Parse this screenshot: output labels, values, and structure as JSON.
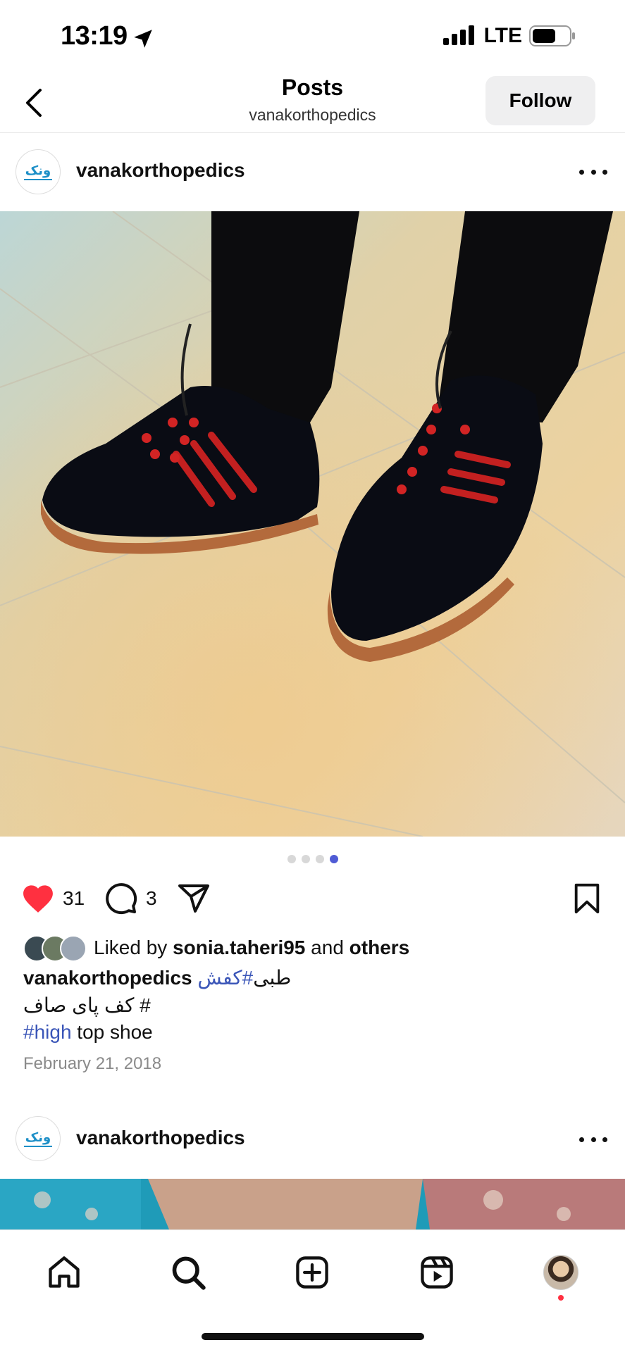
{
  "status_bar": {
    "time": "13:19",
    "network": "LTE"
  },
  "header": {
    "title": "Posts",
    "subtitle": "vanakorthopedics",
    "follow_label": "Follow"
  },
  "posts": [
    {
      "username": "vanakorthopedics",
      "avatar_logo_text": "ونک",
      "likes_count": "31",
      "comments_count": "3",
      "carousel": {
        "total": 4,
        "active_index": 3
      },
      "liked_by": {
        "prefix": "Liked by ",
        "user": "sonia.taheri95",
        "middle": " and ",
        "suffix": "others"
      },
      "caption": {
        "username": "vanakorthopedics",
        "line1_hashtag": "#کفش",
        "line1_text": " طبی",
        "line2": "# کف پای صاف",
        "line3_hashtag": "#high",
        "line3_text": " top shoe"
      },
      "date": "February 21, 2018"
    },
    {
      "username": "vanakorthopedics",
      "avatar_logo_text": "ونک"
    }
  ],
  "colors": {
    "like_red": "#ff3040",
    "hashtag_blue": "#3b56b8",
    "active_dot": "#4f5bd5"
  },
  "nav": {
    "items": [
      "home-icon",
      "search-icon",
      "create-icon",
      "reels-icon",
      "profile-avatar"
    ]
  }
}
